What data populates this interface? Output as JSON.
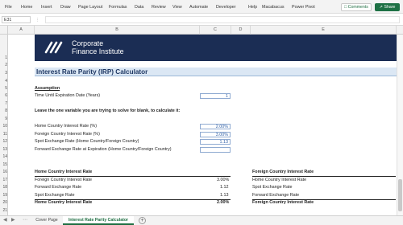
{
  "ribbon": {
    "tabs": [
      "File",
      "Home",
      "Insert",
      "Draw",
      "Page Layout",
      "Formulas",
      "Data",
      "Review",
      "View",
      "Automate",
      "Developer",
      "Help",
      "Macabacus",
      "Power Pivot"
    ],
    "comments_label": "Comments",
    "share_label": "Share"
  },
  "formula_bar": {
    "name_box": "E31",
    "formula": ""
  },
  "columns": [
    "A",
    "B",
    "C",
    "D",
    "E"
  ],
  "rows": [
    "1",
    "2",
    "3",
    "4",
    "5",
    "6",
    "7",
    "8",
    "9",
    "10",
    "11",
    "12",
    "13",
    "14",
    "15",
    "16",
    "17",
    "18",
    "19",
    "20",
    "21"
  ],
  "banner": {
    "line1": "Corporate",
    "line2": "Finance Institute"
  },
  "sheet": {
    "title": "Interest Rate Parity (IRP) Calculator",
    "assumption_header": "Assumption",
    "time_label": "Time Until Expiration Date (Years)",
    "time_value": "1",
    "instruction": "Leave the one variable you are trying to solve for blank, to calculate it:",
    "inputs": [
      {
        "label": "Home Country Interest Rate (%)",
        "value": "2.00%"
      },
      {
        "label": "Foreign Country Interest Rate (%)",
        "value": "3.00%"
      },
      {
        "label": "Spot Exchange Rate (Home Country/Foreign Country)",
        "value": "1.13"
      },
      {
        "label": "Forward Exchange Rate at Expiration (Home Country/Foreign Country)",
        "value": ""
      }
    ],
    "left_block": {
      "header": "Home Country Interest Rate",
      "rows": [
        {
          "label": "Foreign Country Interest Rate",
          "value": "3.00%"
        },
        {
          "label": "Forward Exchange Rate",
          "value": "1.12"
        },
        {
          "label": "Spot Exchange Rate",
          "value": "1.13"
        }
      ],
      "result_label": "Home Country Interest Rate",
      "result_value": "2.00%"
    },
    "right_block": {
      "header": "Foreign Country Interest Rate",
      "rows": [
        {
          "label": "Home Country Interest Rate"
        },
        {
          "label": "Spot Exchange Rate"
        },
        {
          "label": "Forward Exchange Rate"
        }
      ],
      "result_label": "Foreign Country Interest Rate"
    }
  },
  "sheet_tabs": {
    "tab1": "Cover Page",
    "tab2": "Interest Rate Parity Calculator"
  },
  "colors": {
    "banner": "#1b2d54",
    "accent": "#1e7145",
    "title_band": "#dbe7f4"
  }
}
